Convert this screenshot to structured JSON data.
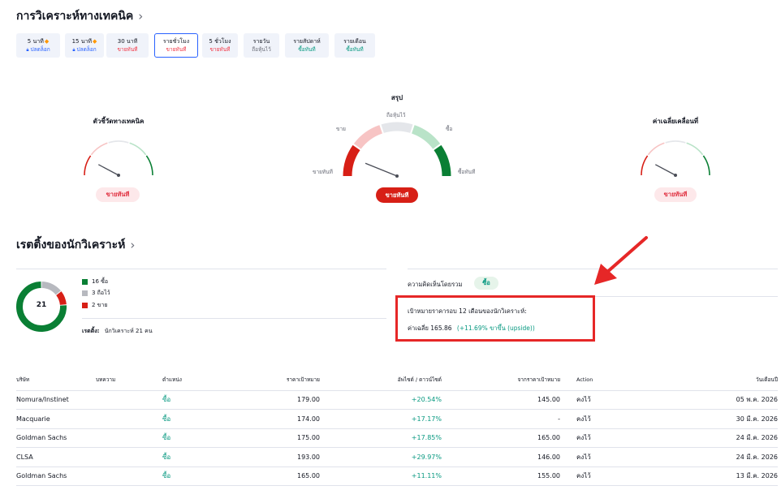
{
  "technical": {
    "title": "การวิเคราะห์ทางเทคนิค",
    "timeframes": [
      {
        "label": "5 นาที",
        "sub": "ปลดล็อก",
        "locked": true,
        "tone": "lock"
      },
      {
        "label": "15 นาที",
        "sub": "ปลดล็อก",
        "locked": true,
        "tone": "lock"
      },
      {
        "label": "30 นาที",
        "sub": "ขายทันที",
        "locked": false,
        "tone": "sell"
      },
      {
        "label": "รายชั่วโมง",
        "sub": "ขายทันที",
        "locked": false,
        "tone": "sell",
        "active": true
      },
      {
        "label": "5 ชั่วโมง",
        "sub": "ขายทันที",
        "locked": false,
        "tone": "sell"
      },
      {
        "label": "รายวัน",
        "sub": "ถือหุ้นไว้",
        "locked": false,
        "tone": "neutral"
      },
      {
        "label": "รายสัปดาห์",
        "sub": "ซื้อทันที",
        "locked": false,
        "tone": "buy"
      },
      {
        "label": "รายเดือน",
        "sub": "ซื้อทันที",
        "locked": false,
        "tone": "buy"
      }
    ],
    "gauges": {
      "indicators": {
        "title": "ตัวชี้วัดทางเทคนิค",
        "verdict": "ขายทันที"
      },
      "summary": {
        "title": "สรุป",
        "verdict": "ขายทันที",
        "labels": {
          "strong_sell": "ขายทันที",
          "sell": "ขาย",
          "neutral": "ถือหุ้นไว้",
          "buy": "ซื้อ",
          "strong_buy": "ซื้อทันที"
        }
      },
      "moving_averages": {
        "title": "ค่าเฉลี่ยเคลื่อนที่",
        "verdict": "ขายทันที"
      }
    }
  },
  "analyst": {
    "title": "เรตติ้งของนักวิเคราะห์",
    "total": "21",
    "legend": [
      {
        "text": "16 ซื้อ",
        "color": "#0a7f34"
      },
      {
        "text": "3 ถือไว้",
        "color": "#b7b9bf"
      },
      {
        "text": "2 ขาย",
        "color": "#d71f16"
      }
    ],
    "rating_label": "เรตติ้ง:",
    "rating_value": "นักวิเคราะห์ 21 คน",
    "overall_label": "ความคิดเห็นโดยรวม",
    "overall_value": "ซื้อ",
    "target_title": "เป้าหมายราคารอบ 12 เดือนของนักวิเคราะห์:",
    "avg_label": "ค่าเฉลี่ย 165.86",
    "avg_change": "(+11.69% ขาขึ้น (upside))"
  },
  "table": {
    "headers": [
      "บริษัท",
      "บทความ",
      "ตำแหน่ง",
      "ราคาเป้าหมาย",
      "อัพไซด์ / ดาวน์ไซด์",
      "จากราคาเป้าหมาย",
      "Action",
      "วันเดือนปี"
    ],
    "rows": [
      {
        "company": "Nomura/Instinet",
        "article": "",
        "position": "ซื้อ",
        "target": "179.00",
        "updown": "+20.54%",
        "from_target": "145.00",
        "action": "คงไว้",
        "date": "05 พ.ค. 2026"
      },
      {
        "company": "Macquarie",
        "article": "",
        "position": "ซื้อ",
        "target": "174.00",
        "updown": "+17.17%",
        "from_target": "-",
        "action": "คงไว้",
        "date": "30 มี.ค. 2026"
      },
      {
        "company": "Goldman Sachs",
        "article": "",
        "position": "ซื้อ",
        "target": "175.00",
        "updown": "+17.85%",
        "from_target": "165.00",
        "action": "คงไว้",
        "date": "24 มี.ค. 2026"
      },
      {
        "company": "CLSA",
        "article": "",
        "position": "ซื้อ",
        "target": "193.00",
        "updown": "+29.97%",
        "from_target": "146.00",
        "action": "คงไว้",
        "date": "24 มี.ค. 2026"
      },
      {
        "company": "Goldman Sachs",
        "article": "",
        "position": "ซื้อ",
        "target": "165.00",
        "updown": "+11.11%",
        "from_target": "155.00",
        "action": "คงไว้",
        "date": "13 มี.ค. 2026"
      }
    ]
  },
  "colors": {
    "strong_sell": "#d71f16",
    "sell": "#f7c4c4",
    "neutral": "#e4e6ea",
    "buy": "#b9e3c8",
    "strong_buy": "#0a7f34",
    "annotation": "#e62727",
    "accent": "#2962ff"
  },
  "icons": {
    "lock": "lock-icon",
    "badge": "flame-badge-icon",
    "chevron": "chevron-right-icon",
    "arrow": "annotation-arrow-icon"
  }
}
